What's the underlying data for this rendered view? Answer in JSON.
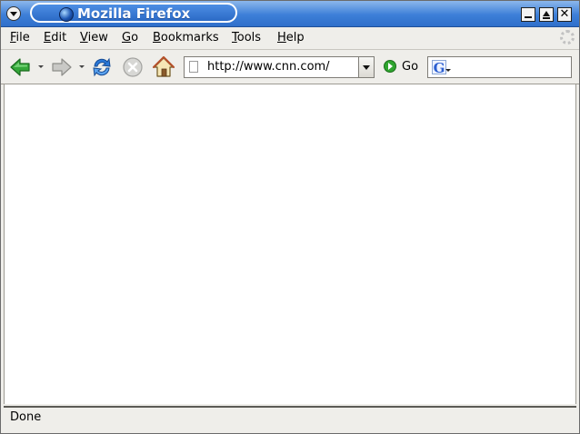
{
  "window": {
    "title": "Mozilla Firefox",
    "close_glyph": "✕"
  },
  "menubar": {
    "items": [
      {
        "mnemonic": "F",
        "rest": "ile"
      },
      {
        "mnemonic": "E",
        "rest": "dit"
      },
      {
        "mnemonic": "V",
        "rest": "iew"
      },
      {
        "mnemonic": "G",
        "rest": "o"
      },
      {
        "mnemonic": "B",
        "rest": "ookmarks"
      },
      {
        "mnemonic": "T",
        "rest": "ools"
      },
      {
        "mnemonic": "H",
        "rest": "elp"
      }
    ]
  },
  "toolbar": {
    "url": "http://www.cnn.com/",
    "go_label": "Go",
    "search_engine_letter": "G"
  },
  "icons": {
    "back": "back-arrow-icon",
    "forward": "forward-arrow-icon",
    "reload": "reload-icon",
    "stop": "stop-icon",
    "home": "home-icon",
    "go": "go-icon"
  },
  "colors": {
    "titlebar": "#3d7fd8",
    "back_arrow": "#35a83a",
    "reload": "#2a78d8",
    "go": "#2fa52f"
  },
  "statusbar": {
    "text": "Done"
  }
}
